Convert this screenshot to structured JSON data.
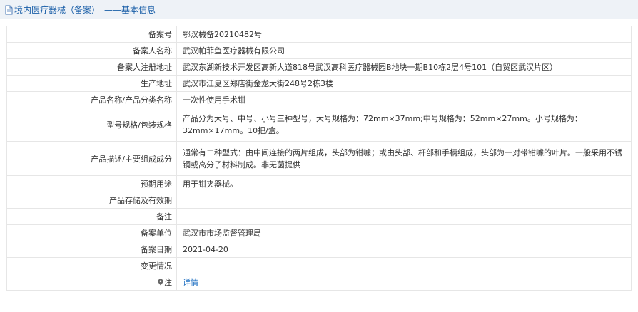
{
  "header": {
    "title": "境内医疗器械（备案）",
    "subtitle": "——基本信息"
  },
  "rows": [
    {
      "label": "备案号",
      "value": "鄂汉械备20210482号"
    },
    {
      "label": "备案人名称",
      "value": "武汉帕菲鱼医疗器械有限公司"
    },
    {
      "label": "备案人注册地址",
      "value": "武汉东湖新技术开发区高新大道818号武汉高科医疗器械园B地块一期B10栋2层4号101（自贸区武汉片区）"
    },
    {
      "label": "生产地址",
      "value": "武汉市江夏区郑店街金龙大街248号2栋3楼"
    },
    {
      "label": "产品名称/产品分类名称",
      "value": "一次性使用手术钳"
    },
    {
      "label": "型号规格/包装规格",
      "value": "产品分为大号、中号、小号三种型号，大号规格为：72mm×37mm;中号规格为：52mm×27mm。小号规格为：32mm×17mm。10把/盒。"
    },
    {
      "label": "产品描述/主要组成成分",
      "value": "通常有二种型式：由中间连接的两片组成，头部为钳噱；或由头部、杆部和手柄组成，头部为一对带钳噱的叶片。一般采用不锈钢或高分子材料制成。非无菌提供"
    },
    {
      "label": "预期用途",
      "value": "用于钳夹器械。"
    },
    {
      "label": "产品存储及有效期",
      "value": ""
    },
    {
      "label": "备注",
      "value": ""
    },
    {
      "label": "备案单位",
      "value": "武汉市市场监督管理局"
    },
    {
      "label": "备案日期",
      "value": "2021-04-20"
    },
    {
      "label": "变更情况",
      "value": ""
    },
    {
      "label": "注",
      "value": "详情"
    }
  ],
  "colors": {
    "header_bg": "#eef2f7",
    "header_text": "#1a5fa8",
    "link": "#1e6fc2",
    "border": "#e6e6e6"
  },
  "icons": {
    "header_icon": "document-icon",
    "note_icon": "location-pin-icon"
  }
}
